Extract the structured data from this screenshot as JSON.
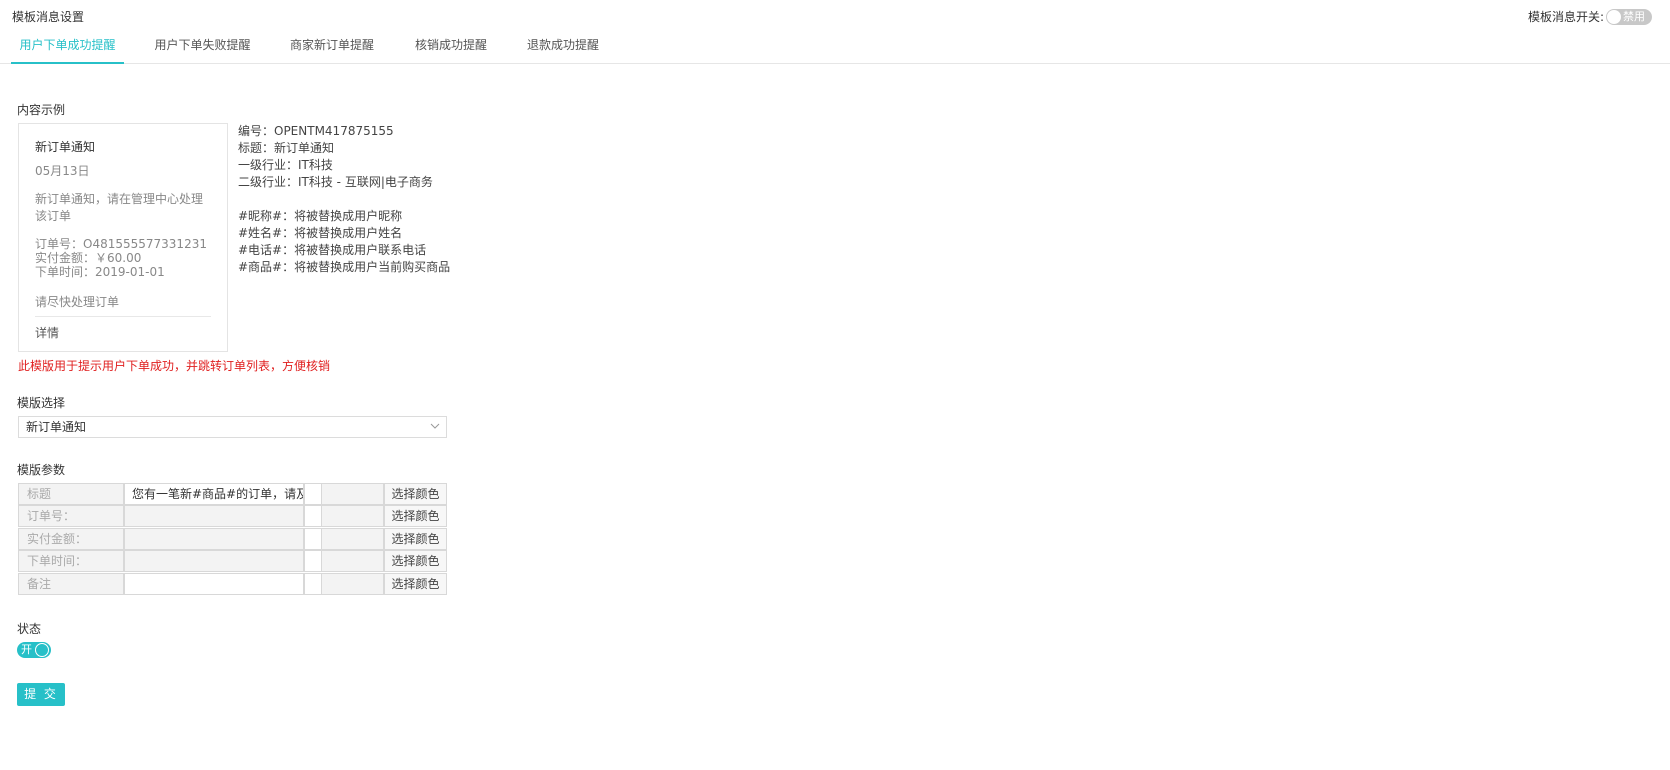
{
  "header": {
    "title": "模板消息设置",
    "switch_label": "模板消息开关:",
    "switch_state": "禁用"
  },
  "tabs": [
    {
      "label": "用户下单成功提醒",
      "active": true
    },
    {
      "label": "用户下单失败提醒",
      "active": false
    },
    {
      "label": "商家新订单提醒",
      "active": false
    },
    {
      "label": "核销成功提醒",
      "active": false
    },
    {
      "label": "退款成功提醒",
      "active": false
    }
  ],
  "example": {
    "label": "内容示例",
    "preview": {
      "title": "新订单通知",
      "date": "05月13日",
      "desc": "新订单通知，请在管理中心处理该订单",
      "fields": [
        "订单号：O481555577331231",
        "实付金额：￥60.00",
        "下单时间：2019-01-01"
      ],
      "remark": "请尽快处理订单",
      "detail": "详情"
    },
    "info": [
      "编号：OPENTM417875155",
      "标题：新订单通知",
      "一级行业：IT科技",
      "二级行业：IT科技 - 互联网|电子商务"
    ],
    "placeholders": [
      "#昵称#：将被替换成用户昵称",
      "#姓名#：将被替换成用户姓名",
      "#电话#：将被替换成用户联系电话",
      "#商品#：将被替换成用户当前购买商品"
    ],
    "warning": "此模版用于提示用户下单成功，并跳转订单列表，方便核销"
  },
  "template_select": {
    "label": "模版选择",
    "value": "新订单通知"
  },
  "params": {
    "label": "模版参数",
    "button_label": "选择颜色",
    "rows": [
      {
        "name": "标题",
        "value": "您有一笔新#商品#的订单，请及时处理"
      },
      {
        "name": "订单号：",
        "value": ""
      },
      {
        "name": "实付金额：",
        "value": ""
      },
      {
        "name": "下单时间：",
        "value": ""
      },
      {
        "name": "备注",
        "value": ""
      }
    ]
  },
  "status": {
    "label": "状态",
    "switch_text": "开"
  },
  "submit_label": "提 交",
  "colors": {
    "accent": "#27c0c8",
    "warning": "#e02020"
  }
}
